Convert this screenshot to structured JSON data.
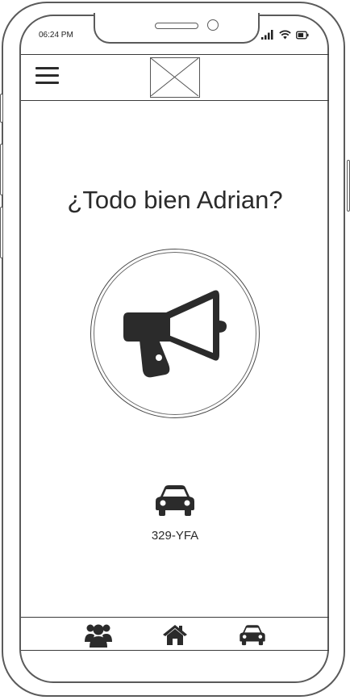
{
  "status_bar": {
    "time": "06:24 PM",
    "icons": [
      "signal-icon",
      "wifi-icon",
      "battery-icon"
    ]
  },
  "header": {
    "menu_icon": "hamburger-menu-icon",
    "logo": "image-placeholder"
  },
  "main": {
    "greeting": "¿Todo bien Adrian?",
    "alert_icon": "megaphone-icon",
    "vehicle_icon": "car-icon",
    "plate": "329-YFA"
  },
  "tabbar": {
    "items": [
      "users-icon",
      "home-icon",
      "car-icon"
    ]
  },
  "colors": {
    "outline": "#5a5a5a",
    "icon": "#2b2b2b",
    "background": "#ffffff"
  }
}
